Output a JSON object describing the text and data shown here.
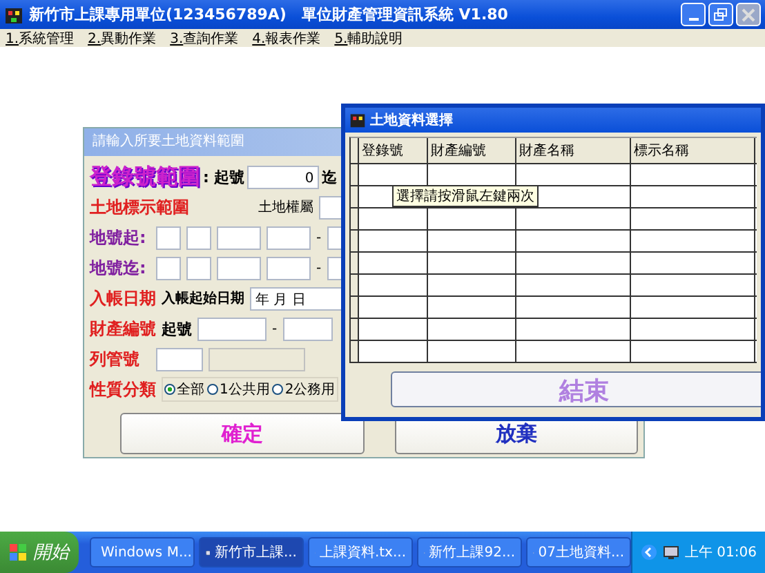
{
  "window": {
    "title": "新竹市上課專用單位(123456789A)　單位財產管理資訊系統  V1.80",
    "menu": [
      {
        "key": "1.",
        "label": "系統管理"
      },
      {
        "key": "2.",
        "label": "異動作業"
      },
      {
        "key": "3.",
        "label": "查詢作業"
      },
      {
        "key": "4.",
        "label": "報表作業"
      },
      {
        "key": "5.",
        "label": "輔助說明"
      }
    ]
  },
  "range_dialog": {
    "title": "請輸入所要土地資料範圍",
    "registration": {
      "label": "登錄號範圍",
      "from_label": ": 起號",
      "from_value": "0",
      "to_label": "迄"
    },
    "land_label": "土地標示範圍",
    "ownership_label": "土地權屬",
    "parcel_rows": [
      {
        "label": "地號起:",
        "separator": "-"
      },
      {
        "label": "地號迄:",
        "separator": "-"
      }
    ],
    "date": {
      "label": "入帳日期",
      "sub_label": "入帳起始日期",
      "value": "年 月 日"
    },
    "property": {
      "label": "財產編號",
      "from_label": "起號",
      "separator": "-"
    },
    "control_label": "列管號",
    "category": {
      "label": "性質分類",
      "options": [
        {
          "label": "全部",
          "selected": true
        },
        {
          "label": "1公共用",
          "selected": false
        },
        {
          "label": "2公務用",
          "selected": false
        }
      ]
    },
    "buttons": [
      {
        "label": "確定",
        "kind": "confirm"
      },
      {
        "label": "放棄",
        "kind": "cancel"
      }
    ]
  },
  "select_dialog": {
    "title": "土地資料選擇",
    "columns": [
      "登錄號",
      "財產編號",
      "財產名稱",
      "標示名稱"
    ],
    "tooltip": "選擇請按滑鼠左鍵兩次",
    "button": "結束"
  },
  "taskbar": {
    "start": "開始",
    "tasks": [
      {
        "label": "Windows M...",
        "selected": false
      },
      {
        "label": "新竹市上課...",
        "selected": true
      },
      {
        "label": "上課資料.tx...",
        "selected": false
      },
      {
        "label": "新竹上課92...",
        "selected": false
      },
      {
        "label": "07土地資料...",
        "selected": false
      }
    ],
    "clock": "上午 01:06"
  }
}
